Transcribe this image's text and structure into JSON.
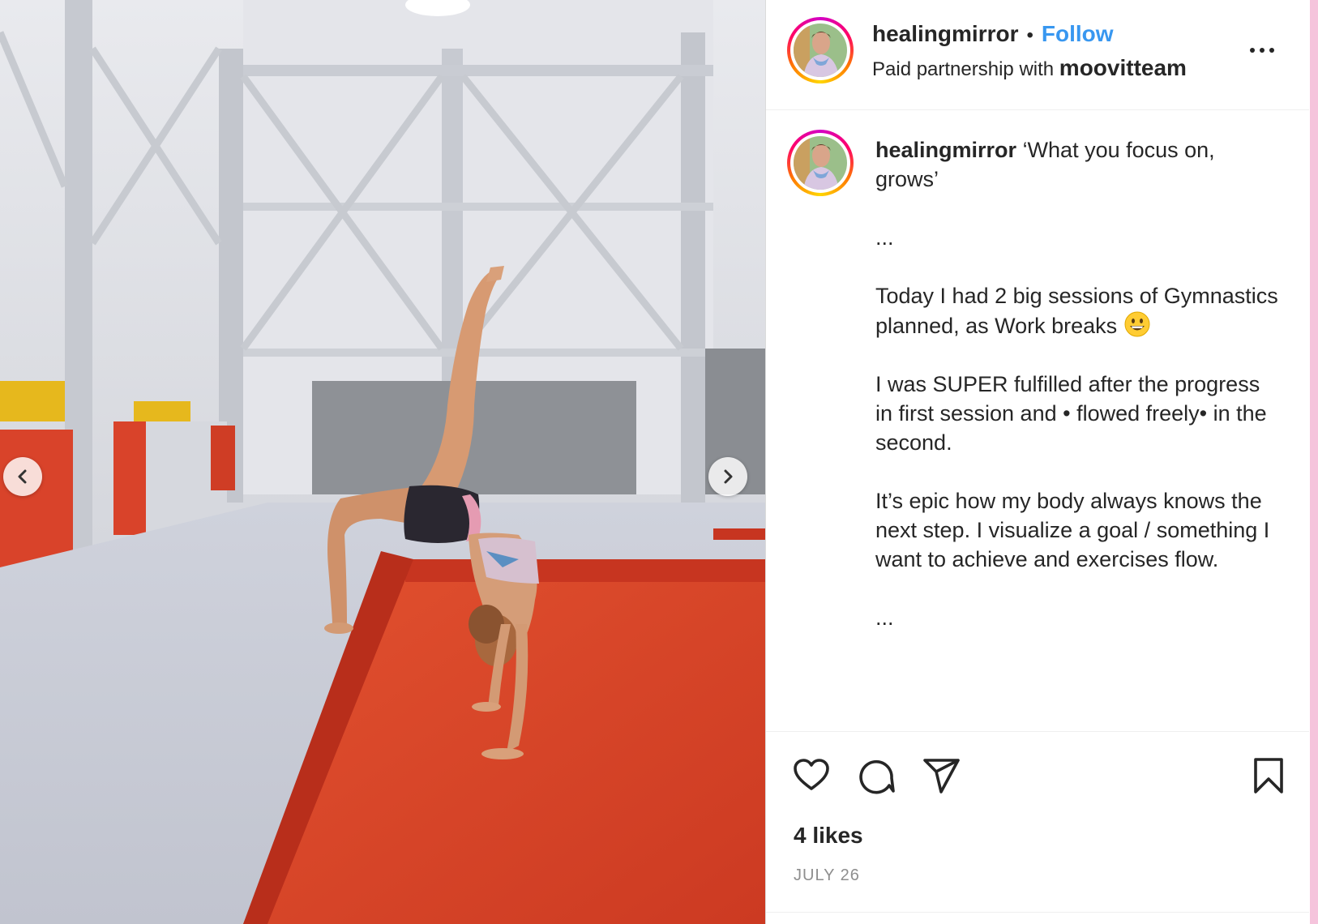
{
  "post": {
    "username": "healingmirror",
    "separator": "•",
    "follow_label": "Follow",
    "partnership_prefix": "Paid partnership with",
    "partner": "moovitteam",
    "more_label": "..."
  },
  "caption": {
    "username": "healingmirror",
    "first_line": "‘What you focus on, grows’",
    "dots1": "...",
    "para1": "Today I had 2 big sessions of Gymnastics planned, as Work breaks",
    "emoji_name": "grinning-face",
    "para2": "I was SUPER fulfilled after the progress in first session and • flowed freely• in the second.",
    "para3": "It’s epic how my body always knows the next step. I visualize a goal / something I want to achieve and exercises flow.",
    "dots2": "..."
  },
  "actions": {
    "icons": [
      "heart-icon",
      "comment-icon",
      "share-icon",
      "bookmark-icon"
    ],
    "likes": "4 likes",
    "date": "JULY 26"
  },
  "media": {
    "description_icons": [
      "chevron-left-icon",
      "chevron-right-icon"
    ]
  },
  "colors": {
    "follow_blue": "#3897f0",
    "text": "#262626",
    "muted": "#8e8e8e",
    "mat_red": "#d9432a",
    "mat_grey": "#c9ccd6"
  }
}
